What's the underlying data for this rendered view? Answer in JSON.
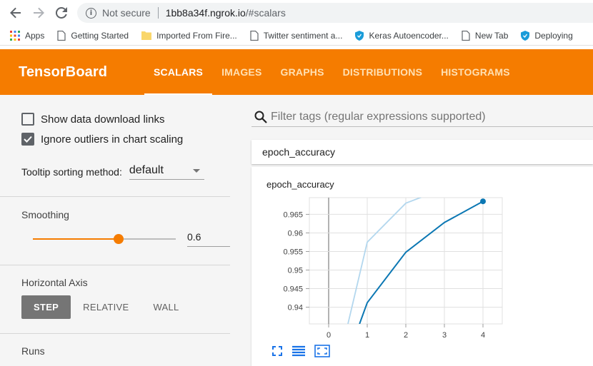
{
  "browser": {
    "not_secure": "Not secure",
    "url_host": "1bb8a34f.ngrok.io",
    "url_path": "/#scalars",
    "bookmarks": [
      {
        "label": "Apps",
        "icon": "apps-grid-icon"
      },
      {
        "label": "Getting Started",
        "icon": "page-icon"
      },
      {
        "label": "Imported From Fire...",
        "icon": "folder-icon"
      },
      {
        "label": "Twitter sentiment a...",
        "icon": "page-icon"
      },
      {
        "label": "Keras Autoencoder...",
        "icon": "shield-icon"
      },
      {
        "label": "New Tab",
        "icon": "page-icon"
      },
      {
        "label": "Deploying",
        "icon": "shield-icon"
      }
    ]
  },
  "header": {
    "title": "TensorBoard",
    "tabs": [
      "SCALARS",
      "IMAGES",
      "GRAPHS",
      "DISTRIBUTIONS",
      "HISTOGRAMS"
    ],
    "active_tab": "SCALARS",
    "color": "#f57c00"
  },
  "sidebar": {
    "show_download_links": {
      "label": "Show data download links",
      "checked": false
    },
    "ignore_outliers": {
      "label": "Ignore outliers in chart scaling",
      "checked": true
    },
    "tooltip_label": "Tooltip sorting method:",
    "tooltip_value": "default",
    "smoothing_label": "Smoothing",
    "smoothing_value": "0.6",
    "smoothing_fraction": 0.6,
    "horizontal_axis_label": "Horizontal Axis",
    "axis_buttons": [
      "STEP",
      "RELATIVE",
      "WALL"
    ],
    "axis_selected": "STEP",
    "runs_label": "Runs"
  },
  "main": {
    "filter_placeholder": "Filter tags (regular expressions supported)",
    "category": "epoch_accuracy",
    "chart_title": "epoch_accuracy"
  },
  "chart_data": {
    "type": "line",
    "title": "epoch_accuracy",
    "xlabel": "",
    "ylabel": "",
    "x_ticks": [
      "0",
      "1",
      "2",
      "3",
      "4"
    ],
    "y_ticks": [
      "0.94",
      "0.945",
      "0.95",
      "0.955",
      "0.96",
      "0.965"
    ],
    "xlim": [
      -0.5,
      4.5
    ],
    "ylim": [
      0.9355,
      0.9695
    ],
    "grid": true,
    "series": [
      {
        "role": "raw",
        "color": "#b3d7ee",
        "x": [
          0.5,
          1,
          2,
          2.5
        ],
        "y": [
          0.9355,
          0.9575,
          0.968,
          0.97
        ]
      },
      {
        "role": "smoothed",
        "color": "#0b77b3",
        "x": [
          0.8,
          1,
          2,
          3,
          4
        ],
        "y": [
          0.9355,
          0.9412,
          0.9548,
          0.9628,
          0.9685
        ]
      }
    ]
  }
}
